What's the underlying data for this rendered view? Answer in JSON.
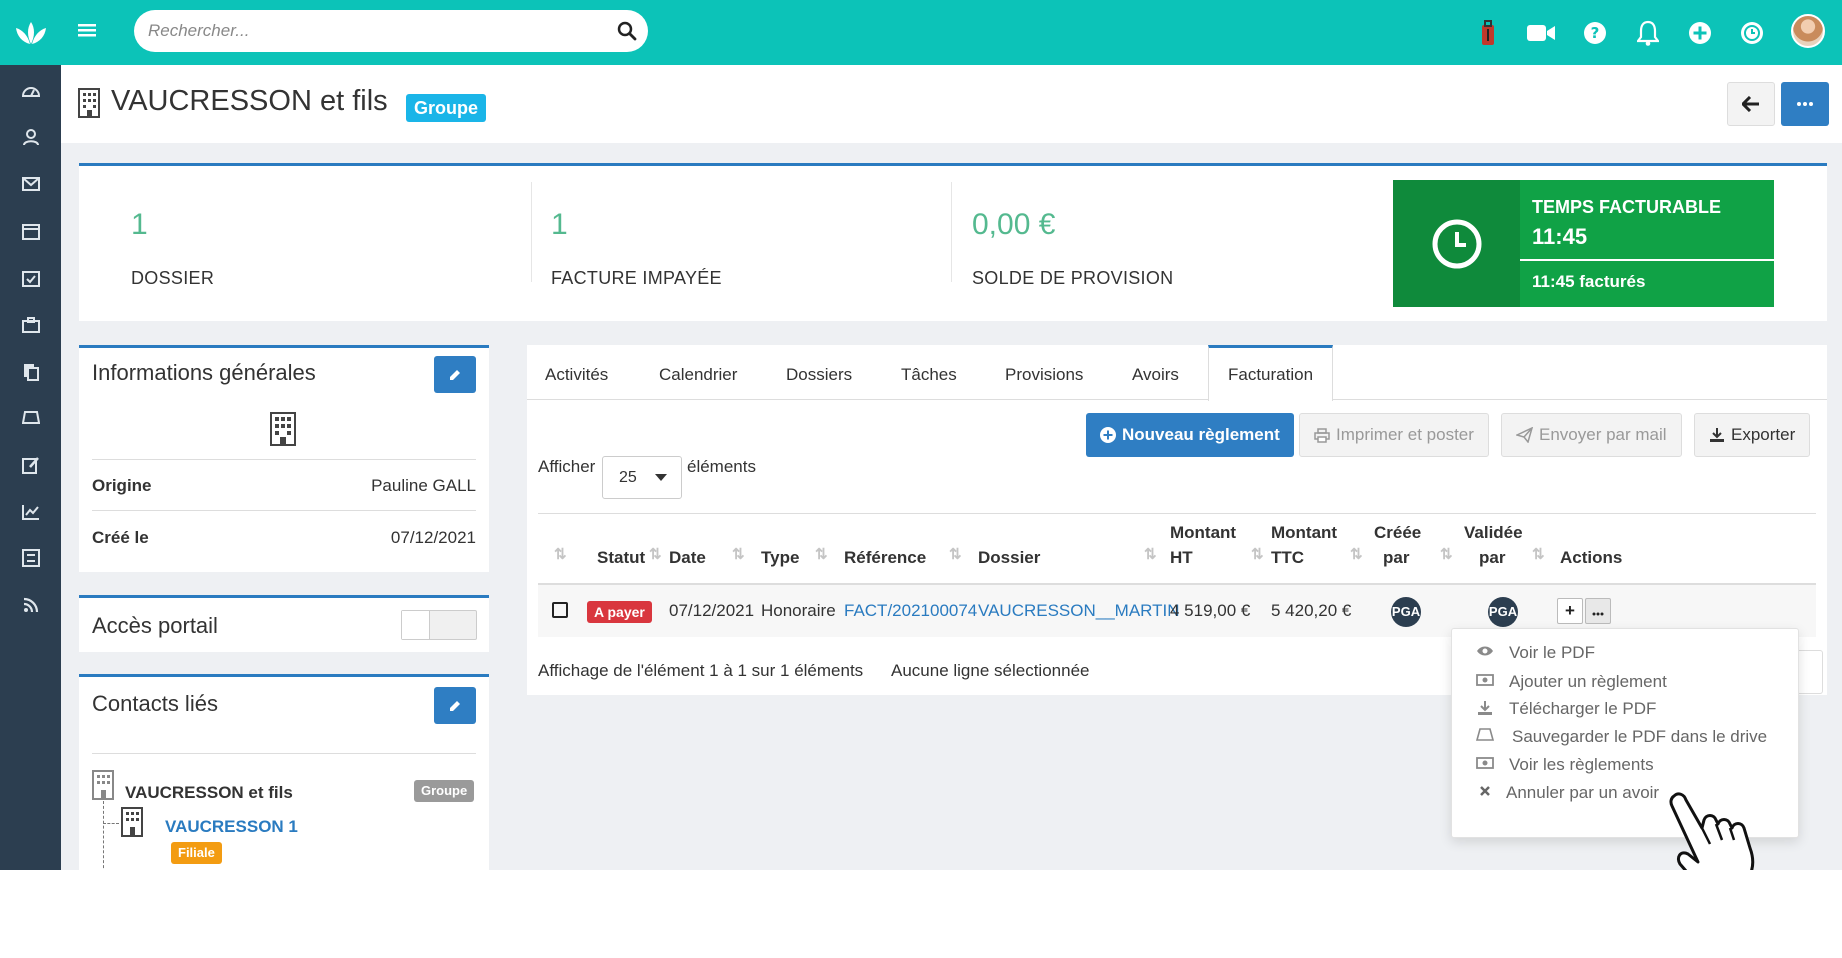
{
  "search": {
    "placeholder": "Rechercher..."
  },
  "header": {
    "title": "VAUCRESSON et fils",
    "badge": "Groupe"
  },
  "kpis": [
    {
      "value": "1",
      "label": "DOSSIER"
    },
    {
      "value": "1",
      "label": "FACTURE IMPAYÉE"
    },
    {
      "value": "0,00 €",
      "label": "SOLDE DE PROVISION"
    }
  ],
  "temps_facturable": {
    "label": "TEMPS FACTURABLE",
    "value": "11:45",
    "factures": "11:45 facturés"
  },
  "infos": {
    "title": "Informations générales",
    "rows": [
      {
        "key": "Origine",
        "value": "Pauline GALL"
      },
      {
        "key": "Créé le",
        "value": "07/12/2021"
      }
    ]
  },
  "portail": {
    "title": "Accès portail"
  },
  "contacts": {
    "title": "Contacts liés",
    "items": [
      {
        "name": "VAUCRESSON et fils",
        "badge": "Groupe"
      },
      {
        "name": "VAUCRESSON 1",
        "badge": "Filiale"
      }
    ]
  },
  "tabs": [
    "Activités",
    "Calendrier",
    "Dossiers",
    "Tâches",
    "Provisions",
    "Avoirs",
    "Facturation"
  ],
  "actions": {
    "nouveau": "Nouveau règlement",
    "imprimer": "Imprimer et poster",
    "envoyer": "Envoyer par mail",
    "exporter": "Exporter"
  },
  "length": {
    "prefix": "Afficher",
    "value": "25",
    "suffix": "éléments"
  },
  "table": {
    "headers": {
      "statut": "Statut",
      "date": "Date",
      "type": "Type",
      "reference": "Référence",
      "dossier": "Dossier",
      "ht_1": "Montant",
      "ht_2": "HT",
      "ttc_1": "Montant",
      "ttc_2": "TTC",
      "creee_1": "Créée",
      "creee_2": "par",
      "validee_1": "Validée",
      "validee_2": "par",
      "actions": "Actions"
    },
    "rows": [
      {
        "statut": "A payer",
        "date": "07/12/2021",
        "type": "Honoraire",
        "reference": "FACT/202100074",
        "dossier": "VAUCRESSON__MARTIN",
        "ht": "4 519,00 €",
        "ttc": "5 420,20 €",
        "creee": "PGA",
        "validee": "PGA"
      }
    ],
    "info": "Affichage de l'élément 1 à 1 sur 1 éléments",
    "selection": "Aucune ligne sélectionnée"
  },
  "dropdown": [
    {
      "label": "Voir le PDF",
      "icon": "eye-icon"
    },
    {
      "label": "Ajouter un règlement",
      "icon": "money-icon"
    },
    {
      "label": "Télécharger le PDF",
      "icon": "download-icon"
    },
    {
      "label": "Sauvegarder le PDF dans le drive",
      "icon": "drive-icon"
    },
    {
      "label": "Voir les règlements",
      "icon": "money-icon"
    },
    {
      "label": "Annuler par un avoir",
      "icon": "times-icon"
    }
  ],
  "colors": {
    "topbar": "#0cc3b8",
    "sidebar": "#2c3e50",
    "primary": "#2f7ec3",
    "kpi_value": "#54b98f",
    "temps_dark": "#0f8a3b",
    "temps_light": "#10a246",
    "badge_groupe": "#1ab5e8",
    "badge_filiale": "#f39c12",
    "status_red": "#d9363e"
  }
}
